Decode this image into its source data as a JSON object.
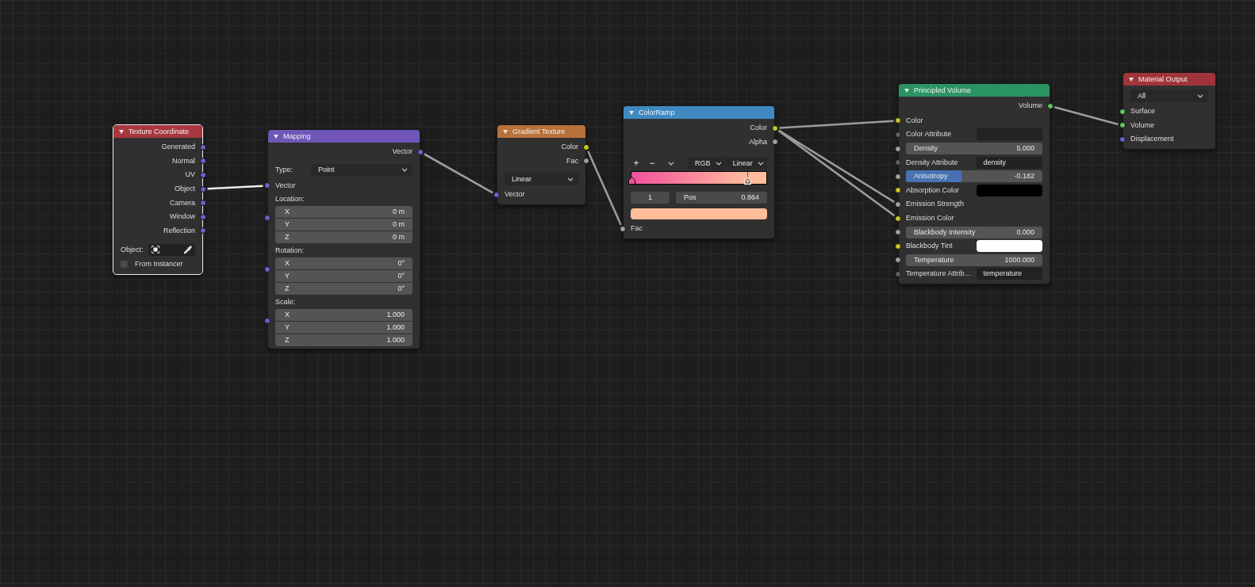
{
  "nodes": [
    {
      "title": "Texture Coordinate",
      "color": "#a9373f",
      "selected": true,
      "expanded": true,
      "rows": [
        {
          "kind": "output",
          "label": "Generated",
          "socket": {
            "color": "#6565cc"
          }
        },
        {
          "kind": "output",
          "label": "Normal",
          "socket": {
            "color": "#6565cc"
          }
        },
        {
          "kind": "output",
          "label": "UV",
          "socket": {
            "color": "#6565cc"
          }
        },
        {
          "kind": "output",
          "label": "Object",
          "socket": {
            "color": "#6565cc",
            "linked": true
          }
        },
        {
          "kind": "output",
          "label": "Camera",
          "socket": {
            "color": "#6565cc"
          }
        },
        {
          "kind": "output",
          "label": "Window",
          "socket": {
            "color": "#6565cc"
          }
        },
        {
          "kind": "output",
          "label": "Reflection",
          "socket": {
            "color": "#6565cc"
          }
        },
        {
          "kind": "object",
          "label": "Object:"
        },
        {
          "kind": "checkbox",
          "label": "From Instancer",
          "checked": false
        }
      ]
    },
    {
      "title": "Mapping",
      "color": "#6f56b8",
      "selected": false,
      "expanded": true,
      "rows": [
        {
          "kind": "output",
          "label": "Vector",
          "socket": {
            "color": "#6565cc",
            "linked": true
          }
        },
        {
          "kind": "dropdown",
          "label": "Type:",
          "value": "Point"
        },
        {
          "kind": "input",
          "label": "Vector",
          "socket": {
            "color": "#6565cc",
            "linked": true
          }
        },
        {
          "kind": "vector",
          "label": "Location:",
          "socket": {
            "color": "#6565cc"
          },
          "fields": [
            {
              "axis": "X",
              "value": "0 m"
            },
            {
              "axis": "Y",
              "value": "0 m"
            },
            {
              "axis": "Z",
              "value": "0 m"
            }
          ]
        },
        {
          "kind": "vector",
          "label": "Rotation:",
          "socket": {
            "color": "#6565cc"
          },
          "fields": [
            {
              "axis": "X",
              "value": "0°"
            },
            {
              "axis": "Y",
              "value": "0°"
            },
            {
              "axis": "Z",
              "value": "0°"
            }
          ]
        },
        {
          "kind": "vector",
          "label": "Scale:",
          "socket": {
            "color": "#6565cc"
          },
          "fields": [
            {
              "axis": "X",
              "value": "1.000"
            },
            {
              "axis": "Y",
              "value": "1.000"
            },
            {
              "axis": "Z",
              "value": "1.000"
            }
          ]
        }
      ]
    },
    {
      "title": "Gradient Texture",
      "color": "#b8713b",
      "selected": false,
      "expanded": true,
      "rows": [
        {
          "kind": "output",
          "label": "Color",
          "socket": {
            "color": "#c7c729",
            "linked": true
          }
        },
        {
          "kind": "output",
          "label": "Fac",
          "socket": {
            "color": "#a1a1a1"
          }
        },
        {
          "kind": "dropdown",
          "value": "Linear"
        },
        {
          "kind": "input",
          "label": "Vector",
          "socket": {
            "color": "#6565cc",
            "linked": true
          }
        }
      ]
    },
    {
      "title": "ColorRamp",
      "color": "#3f89c0",
      "selected": false,
      "expanded": true,
      "rows": [
        {
          "kind": "output",
          "label": "Color",
          "socket": {
            "color": "#c7c729",
            "linked": true
          }
        },
        {
          "kind": "output",
          "label": "Alpha",
          "socket": {
            "color": "#a1a1a1"
          }
        },
        {
          "kind": "ramp_tools",
          "add": "+",
          "remove": "−",
          "color_mode": "RGB",
          "interpolation": "Linear"
        },
        {
          "kind": "ramp",
          "stops": [
            {
              "color": "#f1519c",
              "level": 0,
              "selected": false
            },
            {
              "color": "#ffbd9b",
              "level": 0.864,
              "selected": true
            }
          ]
        },
        {
          "kind": "ramp_stop",
          "index": "1",
          "label": "Pos",
          "value": "0.864"
        },
        {
          "kind": "stop_color"
        },
        {
          "kind": "input",
          "label": "Fac",
          "socket": {
            "color": "#a1a1a1",
            "linked": true
          }
        }
      ]
    },
    {
      "title": "Principled Volume",
      "color": "#2b9463",
      "selected": false,
      "expanded": true,
      "rows": [
        {
          "kind": "output",
          "label": "Volume",
          "socket": {
            "color": "#63c763",
            "linked": true
          }
        },
        {
          "kind": "input",
          "label": "Color",
          "socket": {
            "color": "#c7c729",
            "linked": true
          }
        },
        {
          "kind": "text_field",
          "label": "Color Attribute",
          "socket": {
            "color": "#5e5e5e"
          }
        },
        {
          "kind": "value",
          "label": "Density",
          "value": "5.000",
          "socket": {
            "color": "#a1a1a1"
          }
        },
        {
          "kind": "text_field",
          "label": "Density Attribute",
          "value": "density",
          "socket": {
            "color": "#5e5e5e"
          }
        },
        {
          "kind": "value",
          "label": "Anisotropy",
          "value": "-0.182",
          "level": 0.409,
          "socket": {
            "color": "#a1a1a1"
          }
        },
        {
          "kind": "color",
          "label": "Absorption Color",
          "color": "#000000",
          "socket": {
            "color": "#c7c729"
          }
        },
        {
          "kind": "input",
          "label": "Emission Strength",
          "socket": {
            "color": "#a1a1a1",
            "linked": true
          }
        },
        {
          "kind": "input",
          "label": "Emission Color",
          "socket": {
            "color": "#c7c729",
            "linked": true
          }
        },
        {
          "kind": "value",
          "label": "Blackbody Intensity",
          "value": "0.000",
          "socket": {
            "color": "#a1a1a1"
          }
        },
        {
          "kind": "color",
          "label": "Blackbody Tint",
          "color": "#ffffff",
          "socket": {
            "color": "#c7c729"
          }
        },
        {
          "kind": "value",
          "label": "Temperature",
          "value": "1000.000",
          "socket": {
            "color": "#a1a1a1"
          }
        },
        {
          "kind": "text_field",
          "label": "Temperature Attrib…",
          "value": "temperature",
          "socket": {
            "color": "#5e5e5e"
          }
        }
      ]
    },
    {
      "title": "Material Output",
      "color": "#a1343a",
      "selected": false,
      "expanded": true,
      "rows": [
        {
          "kind": "dropdown",
          "value": "All"
        },
        {
          "kind": "input",
          "label": "Surface",
          "socket": {
            "color": "#63c763"
          }
        },
        {
          "kind": "input",
          "label": "Volume",
          "socket": {
            "color": "#63c763",
            "linked": true
          }
        },
        {
          "kind": "input",
          "label": "Displacement",
          "socket": {
            "color": "#6565cc"
          }
        }
      ]
    }
  ]
}
